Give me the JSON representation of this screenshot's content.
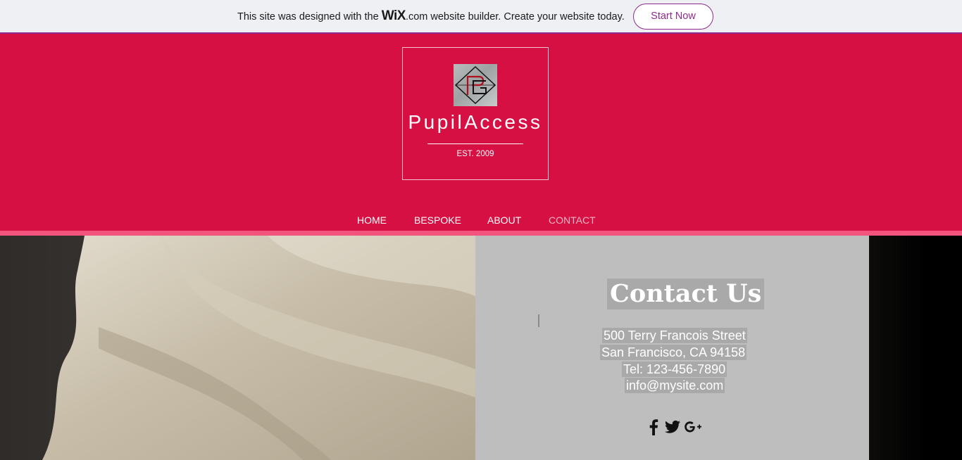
{
  "banner": {
    "prefix": "This site was designed with the",
    "wix_logo": "WiX",
    "logo_suffix": ".com",
    "suffix": "website builder. Create your website today.",
    "cta": "Start Now"
  },
  "header": {
    "brand": "PupilAccess",
    "established": "EST. 2009",
    "logo_icon": "pa-monogram-logo"
  },
  "nav": {
    "items": [
      {
        "label": "HOME",
        "active": false
      },
      {
        "label": "BESPOKE",
        "active": false
      },
      {
        "label": "ABOUT",
        "active": false
      },
      {
        "label": "CONTACT",
        "active": true
      }
    ]
  },
  "contact": {
    "title": "Contact Us",
    "address_line1": "500 Terry Francois Street",
    "address_line2": "San Francisco, CA 94158",
    "phone": "Tel: 123-456-7890",
    "email": "info@mysite.com"
  },
  "social": [
    {
      "icon": "facebook-icon"
    },
    {
      "icon": "twitter-icon"
    },
    {
      "icon": "google-plus-icon"
    }
  ],
  "colors": {
    "header_bg": "#d61043",
    "header_stripe": "#f2547d",
    "wix_accent": "#8e2b8f",
    "contact_panel_bg": "#bebebe"
  }
}
